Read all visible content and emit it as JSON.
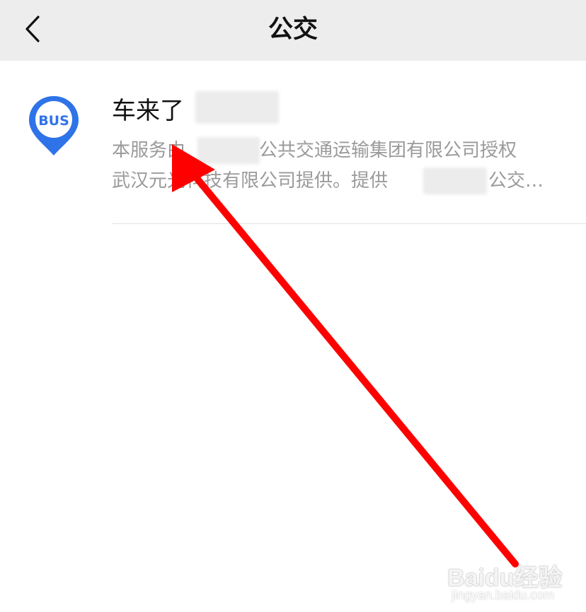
{
  "header": {
    "title": "公交",
    "back_icon": "chevron-left-icon"
  },
  "result": {
    "icon": "bus-location-pin-icon",
    "icon_label": "BUS",
    "icon_color": "#2e73e8",
    "title": "车来了",
    "description_line1_start": "本服务由",
    "description_line1_end": "公共交通运输集团有限公司授权",
    "description_line2_start": "武汉元光科技有限公司提供。提供",
    "description_line2_end": "公交…"
  },
  "annotation": {
    "arrow_color": "#ff0000"
  },
  "watermark": {
    "logo": "Baidu经验",
    "url": "jingyan.baidu.com"
  }
}
